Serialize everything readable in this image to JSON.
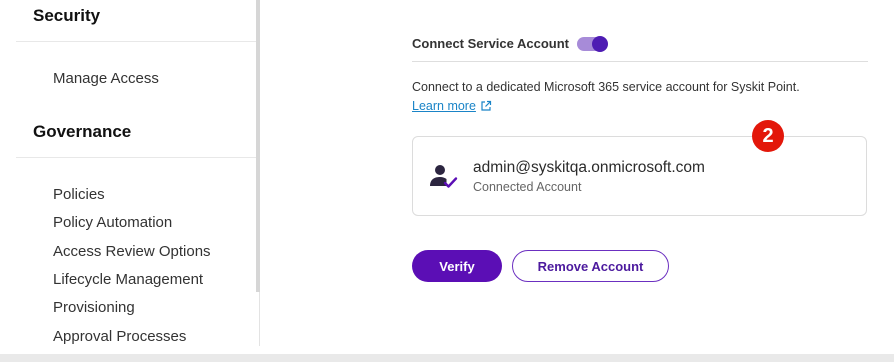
{
  "sidebar": {
    "sections": [
      {
        "title": "Security",
        "items": [
          "Manage Access"
        ]
      },
      {
        "title": "Governance",
        "items": [
          "Policies",
          "Policy Automation",
          "Access Review Options",
          "Lifecycle Management",
          "Provisioning",
          "Approval Processes"
        ]
      }
    ]
  },
  "service_account": {
    "title": "Connect Service Account",
    "toggle_on": true,
    "description": "Connect to a dedicated Microsoft 365 service account for Syskit Point.",
    "learn_more": "Learn more",
    "account": {
      "email": "admin@syskitqa.onmicrosoft.com",
      "status": "Connected Account"
    },
    "step_badge": "2",
    "verify_label": "Verify",
    "remove_label": "Remove Account"
  },
  "colors": {
    "accent": "#5b0eb5",
    "toggle_track": "#a78bd8",
    "link": "#1a84c7",
    "badge": "#e3170a"
  }
}
